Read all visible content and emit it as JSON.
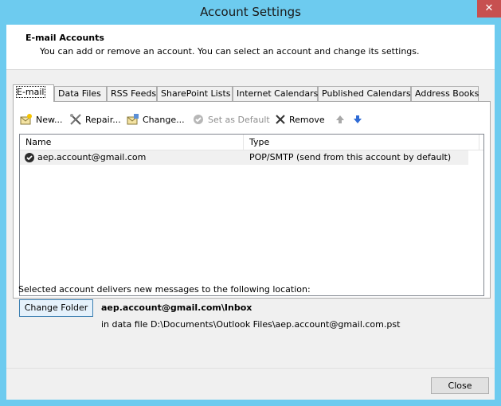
{
  "window": {
    "title": "Account Settings",
    "close_glyph": "✕"
  },
  "header": {
    "title": "E-mail Accounts",
    "subtitle": "You can add or remove an account. You can select an account and change its settings."
  },
  "tabs": [
    {
      "label": "E-mail",
      "active": true
    },
    {
      "label": "Data Files"
    },
    {
      "label": "RSS Feeds"
    },
    {
      "label": "SharePoint Lists"
    },
    {
      "label": "Internet Calendars"
    },
    {
      "label": "Published Calendars"
    },
    {
      "label": "Address Books"
    }
  ],
  "toolbar": {
    "new": {
      "label": "New...",
      "icon": "new-account-icon"
    },
    "repair": {
      "label": "Repair...",
      "icon": "repair-tools-icon"
    },
    "change": {
      "label": "Change...",
      "icon": "change-account-icon"
    },
    "set_default": {
      "label": "Set as Default",
      "icon": "check-circle-icon",
      "enabled": false
    },
    "remove": {
      "label": "Remove",
      "icon": "x-icon"
    },
    "move_up": {
      "icon": "arrow-up-icon"
    },
    "move_down": {
      "icon": "arrow-down-icon"
    }
  },
  "accounts_list": {
    "columns": [
      "Name",
      "Type"
    ],
    "rows": [
      {
        "name": "aep.account@gmail.com",
        "type": "POP/SMTP (send from this account by default)",
        "default": true
      }
    ]
  },
  "delivery": {
    "label": "Selected account delivers new messages to the following location:",
    "change_folder_label": "Change Folder",
    "inbox_path": "aep.account@gmail.com\\Inbox",
    "data_file": "in data file D:\\Documents\\Outlook Files\\aep.account@gmail.com.pst"
  },
  "footer": {
    "close_label": "Close"
  },
  "colors": {
    "title_bar": "#6dcbef",
    "close_button": "#c75050",
    "accent_blue": "#3c7fb1"
  }
}
